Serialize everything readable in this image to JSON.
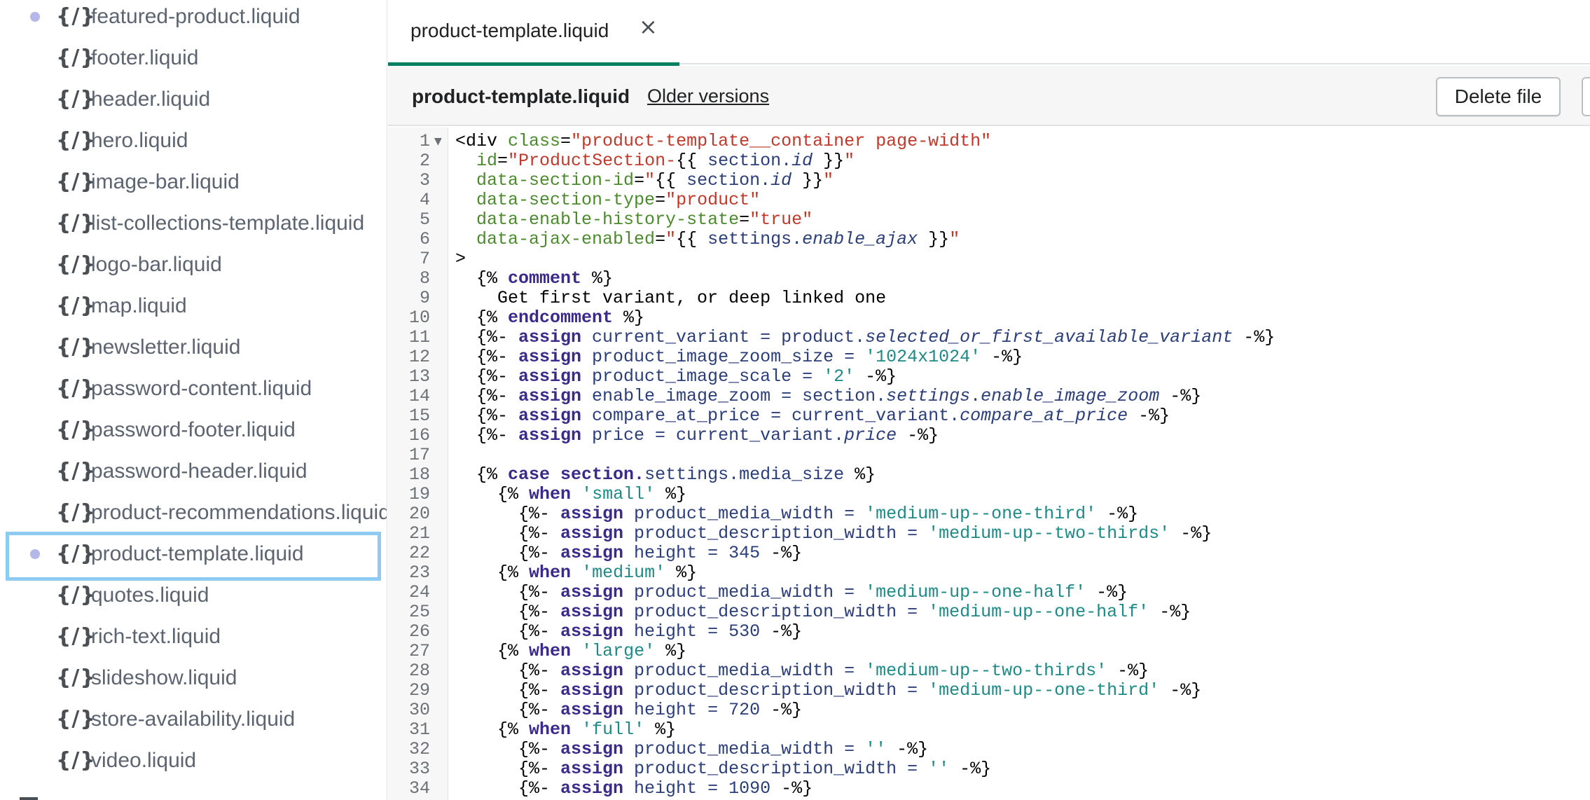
{
  "sidebar": {
    "files": [
      {
        "name": "featured-product.liquid",
        "modified": true,
        "selected": false
      },
      {
        "name": "footer.liquid",
        "modified": false,
        "selected": false
      },
      {
        "name": "header.liquid",
        "modified": false,
        "selected": false
      },
      {
        "name": "hero.liquid",
        "modified": false,
        "selected": false
      },
      {
        "name": "image-bar.liquid",
        "modified": false,
        "selected": false
      },
      {
        "name": "list-collections-template.liquid",
        "modified": false,
        "selected": false
      },
      {
        "name": "logo-bar.liquid",
        "modified": false,
        "selected": false
      },
      {
        "name": "map.liquid",
        "modified": false,
        "selected": false
      },
      {
        "name": "newsletter.liquid",
        "modified": false,
        "selected": false
      },
      {
        "name": "password-content.liquid",
        "modified": false,
        "selected": false
      },
      {
        "name": "password-footer.liquid",
        "modified": false,
        "selected": false
      },
      {
        "name": "password-header.liquid",
        "modified": false,
        "selected": false
      },
      {
        "name": "product-recommendations.liquid",
        "modified": false,
        "selected": false
      },
      {
        "name": "product-template.liquid",
        "modified": true,
        "selected": true
      },
      {
        "name": "quotes.liquid",
        "modified": false,
        "selected": false
      },
      {
        "name": "rich-text.liquid",
        "modified": false,
        "selected": false
      },
      {
        "name": "slideshow.liquid",
        "modified": false,
        "selected": false
      },
      {
        "name": "store-availability.liquid",
        "modified": false,
        "selected": false
      },
      {
        "name": "video.liquid",
        "modified": false,
        "selected": false
      }
    ],
    "file_icon": "{/}"
  },
  "tabs": [
    {
      "label": "product-template.liquid",
      "close": "×",
      "active": true
    }
  ],
  "file_header": {
    "title": "product-template.liquid",
    "older_versions": "Older versions",
    "delete_button": "Delete file"
  },
  "colors": {
    "accent": "#008060",
    "selected_outline": "#8ecbf1",
    "modified_dot": "#b4b7e8"
  },
  "code_lines": [
    {
      "n": "1",
      "fold": true,
      "tokens": [
        [
          "t",
          "<div "
        ],
        [
          "a",
          "class"
        ],
        [
          "t",
          "="
        ],
        [
          "s",
          "\"product-template__container page-width\""
        ]
      ]
    },
    {
      "n": "2",
      "tokens": [
        [
          "t",
          "  "
        ],
        [
          "a",
          "id"
        ],
        [
          "t",
          "="
        ],
        [
          "s",
          "\"ProductSection-"
        ],
        [
          "t",
          "{{ "
        ],
        [
          "v",
          "section."
        ],
        [
          "i",
          "id"
        ],
        [
          "t",
          " }}"
        ],
        [
          "s",
          "\""
        ]
      ]
    },
    {
      "n": "3",
      "tokens": [
        [
          "t",
          "  "
        ],
        [
          "a",
          "data-section-id"
        ],
        [
          "t",
          "="
        ],
        [
          "s",
          "\""
        ],
        [
          "t",
          "{{ "
        ],
        [
          "v",
          "section."
        ],
        [
          "i",
          "id"
        ],
        [
          "t",
          " }}"
        ],
        [
          "s",
          "\""
        ]
      ]
    },
    {
      "n": "4",
      "tokens": [
        [
          "t",
          "  "
        ],
        [
          "a",
          "data-section-type"
        ],
        [
          "t",
          "="
        ],
        [
          "s",
          "\"product\""
        ]
      ]
    },
    {
      "n": "5",
      "tokens": [
        [
          "t",
          "  "
        ],
        [
          "a",
          "data-enable-history-state"
        ],
        [
          "t",
          "="
        ],
        [
          "s",
          "\"true\""
        ]
      ]
    },
    {
      "n": "6",
      "tokens": [
        [
          "t",
          "  "
        ],
        [
          "a",
          "data-ajax-enabled"
        ],
        [
          "t",
          "="
        ],
        [
          "s",
          "\""
        ],
        [
          "t",
          "{{ "
        ],
        [
          "v",
          "settings."
        ],
        [
          "i",
          "enable_ajax"
        ],
        [
          "t",
          " }}"
        ],
        [
          "s",
          "\""
        ]
      ]
    },
    {
      "n": "7",
      "tokens": [
        [
          "t",
          ">"
        ]
      ]
    },
    {
      "n": "8",
      "tokens": [
        [
          "t",
          "  {% "
        ],
        [
          "k",
          "comment"
        ],
        [
          "t",
          " %}"
        ]
      ]
    },
    {
      "n": "9",
      "tokens": [
        [
          "t",
          "    Get first variant, or deep linked one"
        ]
      ]
    },
    {
      "n": "10",
      "tokens": [
        [
          "t",
          "  {% "
        ],
        [
          "k",
          "endcomment"
        ],
        [
          "t",
          " %}"
        ]
      ]
    },
    {
      "n": "11",
      "tokens": [
        [
          "t",
          "  {%- "
        ],
        [
          "k",
          "assign"
        ],
        [
          "v",
          " current_variant = product."
        ],
        [
          "i",
          "selected_or_first_available_variant"
        ],
        [
          "t",
          " -%}"
        ]
      ]
    },
    {
      "n": "12",
      "tokens": [
        [
          "t",
          "  {%- "
        ],
        [
          "k",
          "assign"
        ],
        [
          "v",
          " product_image_zoom_size = "
        ],
        [
          "l",
          "'1024x1024'"
        ],
        [
          "t",
          " -%}"
        ]
      ]
    },
    {
      "n": "13",
      "tokens": [
        [
          "t",
          "  {%- "
        ],
        [
          "k",
          "assign"
        ],
        [
          "v",
          " product_image_scale = "
        ],
        [
          "l",
          "'2'"
        ],
        [
          "t",
          " -%}"
        ]
      ]
    },
    {
      "n": "14",
      "tokens": [
        [
          "t",
          "  {%- "
        ],
        [
          "k",
          "assign"
        ],
        [
          "v",
          " enable_image_zoom = section."
        ],
        [
          "i",
          "settings"
        ],
        [
          "v",
          "."
        ],
        [
          "i",
          "enable_image_zoom"
        ],
        [
          "t",
          " -%}"
        ]
      ]
    },
    {
      "n": "15",
      "tokens": [
        [
          "t",
          "  {%- "
        ],
        [
          "k",
          "assign"
        ],
        [
          "v",
          " compare_at_price = current_variant."
        ],
        [
          "i",
          "compare_at_price"
        ],
        [
          "t",
          " -%}"
        ]
      ]
    },
    {
      "n": "16",
      "tokens": [
        [
          "t",
          "  {%- "
        ],
        [
          "k",
          "assign"
        ],
        [
          "v",
          " price = current_variant."
        ],
        [
          "i",
          "price"
        ],
        [
          "t",
          " -%}"
        ]
      ]
    },
    {
      "n": "17",
      "tokens": []
    },
    {
      "n": "18",
      "tokens": [
        [
          "t",
          "  {% "
        ],
        [
          "k",
          "case section."
        ],
        [
          "v",
          "settings.media_size"
        ],
        [
          "t",
          " %}"
        ]
      ]
    },
    {
      "n": "19",
      "tokens": [
        [
          "t",
          "    {% "
        ],
        [
          "k",
          "when"
        ],
        [
          "t",
          " "
        ],
        [
          "l",
          "'small'"
        ],
        [
          "t",
          " %}"
        ]
      ]
    },
    {
      "n": "20",
      "tokens": [
        [
          "t",
          "      {%- "
        ],
        [
          "k",
          "assign"
        ],
        [
          "v",
          " product_media_width = "
        ],
        [
          "l",
          "'medium-up--one-third'"
        ],
        [
          "t",
          " -%}"
        ]
      ]
    },
    {
      "n": "21",
      "tokens": [
        [
          "t",
          "      {%- "
        ],
        [
          "k",
          "assign"
        ],
        [
          "v",
          " product_description_width = "
        ],
        [
          "l",
          "'medium-up--two-thirds'"
        ],
        [
          "t",
          " -%}"
        ]
      ]
    },
    {
      "n": "22",
      "tokens": [
        [
          "t",
          "      {%- "
        ],
        [
          "k",
          "assign"
        ],
        [
          "v",
          " height = 345"
        ],
        [
          "t",
          " -%}"
        ]
      ]
    },
    {
      "n": "23",
      "tokens": [
        [
          "t",
          "    {% "
        ],
        [
          "k",
          "when"
        ],
        [
          "t",
          " "
        ],
        [
          "l",
          "'medium'"
        ],
        [
          "t",
          " %}"
        ]
      ]
    },
    {
      "n": "24",
      "tokens": [
        [
          "t",
          "      {%- "
        ],
        [
          "k",
          "assign"
        ],
        [
          "v",
          " product_media_width = "
        ],
        [
          "l",
          "'medium-up--one-half'"
        ],
        [
          "t",
          " -%}"
        ]
      ]
    },
    {
      "n": "25",
      "tokens": [
        [
          "t",
          "      {%- "
        ],
        [
          "k",
          "assign"
        ],
        [
          "v",
          " product_description_width = "
        ],
        [
          "l",
          "'medium-up--one-half'"
        ],
        [
          "t",
          " -%}"
        ]
      ]
    },
    {
      "n": "26",
      "tokens": [
        [
          "t",
          "      {%- "
        ],
        [
          "k",
          "assign"
        ],
        [
          "v",
          " height = 530"
        ],
        [
          "t",
          " -%}"
        ]
      ]
    },
    {
      "n": "27",
      "tokens": [
        [
          "t",
          "    {% "
        ],
        [
          "k",
          "when"
        ],
        [
          "t",
          " "
        ],
        [
          "l",
          "'large'"
        ],
        [
          "t",
          " %}"
        ]
      ]
    },
    {
      "n": "28",
      "tokens": [
        [
          "t",
          "      {%- "
        ],
        [
          "k",
          "assign"
        ],
        [
          "v",
          " product_media_width = "
        ],
        [
          "l",
          "'medium-up--two-thirds'"
        ],
        [
          "t",
          " -%}"
        ]
      ]
    },
    {
      "n": "29",
      "tokens": [
        [
          "t",
          "      {%- "
        ],
        [
          "k",
          "assign"
        ],
        [
          "v",
          " product_description_width = "
        ],
        [
          "l",
          "'medium-up--one-third'"
        ],
        [
          "t",
          " -%}"
        ]
      ]
    },
    {
      "n": "30",
      "tokens": [
        [
          "t",
          "      {%- "
        ],
        [
          "k",
          "assign"
        ],
        [
          "v",
          " height = 720"
        ],
        [
          "t",
          " -%}"
        ]
      ]
    },
    {
      "n": "31",
      "tokens": [
        [
          "t",
          "    {% "
        ],
        [
          "k",
          "when"
        ],
        [
          "t",
          " "
        ],
        [
          "l",
          "'full'"
        ],
        [
          "t",
          " %}"
        ]
      ]
    },
    {
      "n": "32",
      "tokens": [
        [
          "t",
          "      {%- "
        ],
        [
          "k",
          "assign"
        ],
        [
          "v",
          " product_media_width = "
        ],
        [
          "l",
          "''"
        ],
        [
          "t",
          " -%}"
        ]
      ]
    },
    {
      "n": "33",
      "tokens": [
        [
          "t",
          "      {%- "
        ],
        [
          "k",
          "assign"
        ],
        [
          "v",
          " product_description_width = "
        ],
        [
          "l",
          "''"
        ],
        [
          "t",
          " -%}"
        ]
      ]
    },
    {
      "n": "34",
      "tokens": [
        [
          "t",
          "      {%- "
        ],
        [
          "k",
          "assign"
        ],
        [
          "v",
          " height = 1090"
        ],
        [
          "t",
          " -%}"
        ]
      ]
    }
  ]
}
